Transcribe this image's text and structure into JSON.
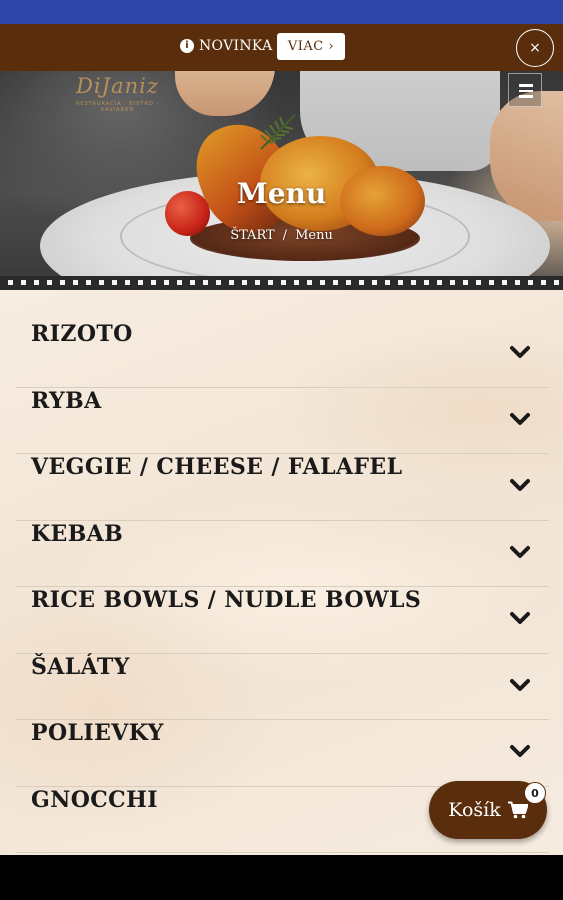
{
  "promo": {
    "icon": "info-icon",
    "text": "NOVINKA",
    "button_label": "VIAC ›",
    "close_label": "×"
  },
  "header": {
    "logo_text": "DiJaniz",
    "logo_tagline": "RESTAURACIA · BISTRO · KAVIAREN",
    "menu_icon": "hamburger-icon"
  },
  "hero": {
    "title": "Menu",
    "breadcrumb": {
      "home": "ŠTART",
      "separator": "/",
      "current": "Menu"
    }
  },
  "menu_categories": [
    {
      "label": "RIZOTO"
    },
    {
      "label": "RYBA"
    },
    {
      "label": "VEGGIE / CHEESE / FALAFEL"
    },
    {
      "label": "KEBAB"
    },
    {
      "label": "RICE BOWLS / NUDLE BOWLS"
    },
    {
      "label": "ŠALÁTY"
    },
    {
      "label": "POLIEVKY"
    },
    {
      "label": "GNOCCHI"
    }
  ],
  "cart": {
    "label": "Košík",
    "count": "0",
    "icon": "cart-icon"
  },
  "colors": {
    "brand_brown": "#5a2e0c",
    "status_bar_blue": "#2f46a8",
    "content_background": "#f4e8da"
  }
}
